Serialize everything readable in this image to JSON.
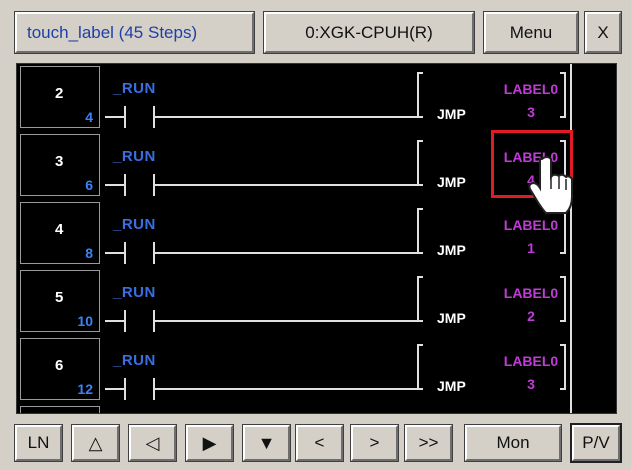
{
  "header": {
    "title": "touch_label (45 Steps)",
    "cpu": "0:XGK-CPUH(R)",
    "menu": "Menu",
    "close": "X"
  },
  "rungs": [
    {
      "step": "2",
      "addr": "4",
      "contact": "_RUN",
      "instr": "JMP",
      "label": "LABEL0",
      "arg": "3"
    },
    {
      "step": "3",
      "addr": "6",
      "contact": "_RUN",
      "instr": "JMP",
      "label": "LABEL0",
      "arg": "4"
    },
    {
      "step": "4",
      "addr": "8",
      "contact": "_RUN",
      "instr": "JMP",
      "label": "LABEL0",
      "arg": "1"
    },
    {
      "step": "5",
      "addr": "10",
      "contact": "_RUN",
      "instr": "JMP",
      "label": "LABEL0",
      "arg": "2"
    },
    {
      "step": "6",
      "addr": "12",
      "contact": "_RUN",
      "instr": "JMP",
      "label": "LABEL0",
      "arg": "3"
    }
  ],
  "toolbar": {
    "ln": "LN",
    "up_hollow": "△",
    "left_hollow": "◁",
    "right_solid": "▶",
    "down_solid": "▼",
    "prev": "<",
    "next": ">",
    "fast_next": ">>",
    "mon": "Mon",
    "pv": "P/V"
  },
  "colors": {
    "label": "#c13bd8",
    "contact": "#3b6fe0",
    "highlight": "#e01b24"
  }
}
